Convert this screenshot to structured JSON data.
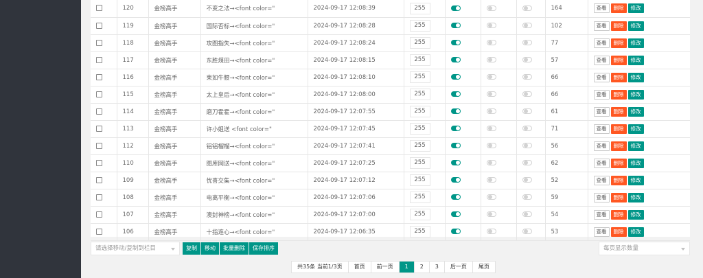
{
  "table": {
    "rows": [
      {
        "id": "120",
        "author": "金榜高手",
        "title": "不变之法→<font color=\"",
        "time": "2024-09-17 12:08:39",
        "sort": "255",
        "s1": true,
        "s2": false,
        "s3": false,
        "views": "164"
      },
      {
        "id": "119",
        "author": "金榜高手",
        "title": "国际否标→<font color=\"",
        "time": "2024-09-17 12:08:28",
        "sort": "255",
        "s1": true,
        "s2": false,
        "s3": false,
        "views": "102"
      },
      {
        "id": "118",
        "author": "金榜高手",
        "title": "攻图指失→<font color=\"",
        "time": "2024-09-17 12:08:24",
        "sort": "255",
        "s1": true,
        "s2": false,
        "s3": false,
        "views": "77"
      },
      {
        "id": "117",
        "author": "金榜高手",
        "title": "东胜煤田→<font color=\"",
        "time": "2024-09-17 12:08:15",
        "sort": "255",
        "s1": true,
        "s2": false,
        "s3": false,
        "views": "57"
      },
      {
        "id": "116",
        "author": "金榜高手",
        "title": "束如牛腰→<font color=\"",
        "time": "2024-09-17 12:08:10",
        "sort": "255",
        "s1": true,
        "s2": false,
        "s3": false,
        "views": "66"
      },
      {
        "id": "115",
        "author": "金榜高手",
        "title": "太上皇后→<font color=\"",
        "time": "2024-09-17 12:08:00",
        "sort": "255",
        "s1": true,
        "s2": false,
        "s3": false,
        "views": "66"
      },
      {
        "id": "114",
        "author": "金榜高手",
        "title": "磨刀霍霍→<font color=\"",
        "time": "2024-09-17 12:07:55",
        "sort": "255",
        "s1": true,
        "s2": false,
        "s3": false,
        "views": "61"
      },
      {
        "id": "113",
        "author": "金榜高手",
        "title": "许小姐送 <font color=\"",
        "time": "2024-09-17 12:07:45",
        "sort": "255",
        "s1": true,
        "s2": false,
        "s3": false,
        "views": "71"
      },
      {
        "id": "112",
        "author": "金榜高手",
        "title": "铝铝榴榴→<font color=\"",
        "time": "2024-09-17 12:07:41",
        "sort": "255",
        "s1": true,
        "s2": false,
        "s3": false,
        "views": "56"
      },
      {
        "id": "110",
        "author": "金榜高手",
        "title": "图库网送→<font color=\"",
        "time": "2024-09-17 12:07:25",
        "sort": "255",
        "s1": true,
        "s2": false,
        "s3": false,
        "views": "62"
      },
      {
        "id": "109",
        "author": "金榜高手",
        "title": "忧喜交集→<font color=\"",
        "time": "2024-09-17 12:07:12",
        "sort": "255",
        "s1": true,
        "s2": false,
        "s3": false,
        "views": "52"
      },
      {
        "id": "108",
        "author": "金榜高手",
        "title": "电离平衡→<font color=\"",
        "time": "2024-09-17 12:07:06",
        "sort": "255",
        "s1": true,
        "s2": false,
        "s3": false,
        "views": "59"
      },
      {
        "id": "107",
        "author": "金榜高手",
        "title": "澳封神榜→<font color=\"",
        "time": "2024-09-17 12:07:00",
        "sort": "255",
        "s1": true,
        "s2": false,
        "s3": false,
        "views": "54"
      },
      {
        "id": "106",
        "author": "金榜高手",
        "title": "十指连心→<font color=\"",
        "time": "2024-09-17 12:06:35",
        "sort": "255",
        "s1": true,
        "s2": false,
        "s3": false,
        "views": "53"
      }
    ],
    "view_label": "查看",
    "delete_label": "删除",
    "edit_label": "修改"
  },
  "toolbar": {
    "move_select_placeholder": "请选择移动/复制到栏目",
    "copy_label": "复制",
    "move_label": "移动",
    "batch_delete_label": "批量删除",
    "save_sort_label": "保存排序",
    "page_size_placeholder": "每页显示数量"
  },
  "pagination": {
    "info": "共35条 当前1/3页",
    "first": "首页",
    "prev": "前一页",
    "pages": [
      "1",
      "2",
      "3"
    ],
    "current": "1",
    "next": "后一页",
    "last": "尾页"
  },
  "colors": {
    "accent": "#009688",
    "danger": "#ff5722",
    "sidebar": "#30343c"
  }
}
